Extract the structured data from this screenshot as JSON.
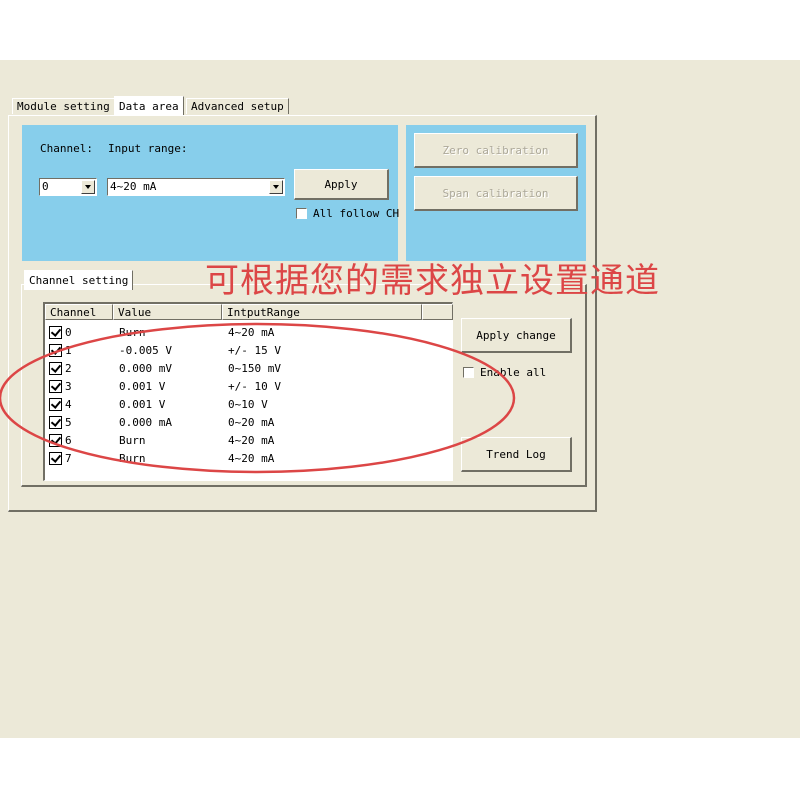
{
  "tabs": [
    {
      "label": "Module setting",
      "active": false
    },
    {
      "label": "Data area",
      "active": true
    },
    {
      "label": "Advanced setup",
      "active": false
    }
  ],
  "top": {
    "channel_label": "Channel:",
    "channel_value": "0",
    "input_range_label": "Input range:",
    "input_range_value": "4~20 mA",
    "apply_label": "Apply",
    "all_follow_label": "All follow CH",
    "all_follow_checked": false,
    "zero_calibration_label": "Zero calibration",
    "span_calibration_label": "Span calibration",
    "panel_color": "#87ceeb"
  },
  "channel_setting": {
    "tab_label": "Channel setting",
    "columns": [
      "Channel",
      "Value",
      "IntputRange"
    ],
    "rows": [
      {
        "channel": "0",
        "value": "Burn",
        "range": "4~20 mA",
        "checked": true
      },
      {
        "channel": "1",
        "value": "-0.005 V",
        "range": "+/- 15 V",
        "checked": true
      },
      {
        "channel": "2",
        "value": "0.000 mV",
        "range": "0~150 mV",
        "checked": true
      },
      {
        "channel": "3",
        "value": "0.001 V",
        "range": "+/- 10 V",
        "checked": true
      },
      {
        "channel": "4",
        "value": "0.001 V",
        "range": "0~10 V",
        "checked": true
      },
      {
        "channel": "5",
        "value": "0.000 mA",
        "range": "0~20 mA",
        "checked": true
      },
      {
        "channel": "6",
        "value": "Burn",
        "range": "4~20 mA",
        "checked": true
      },
      {
        "channel": "7",
        "value": "Burn",
        "range": "4~20 mA",
        "checked": true
      }
    ],
    "apply_change_label": "Apply change",
    "enable_all_label": "Enable all",
    "enable_all_checked": false,
    "trend_log_label": "Trend Log"
  },
  "annotation": {
    "text": "可根据您的需求独立设置通道",
    "color": "#dc4646"
  }
}
